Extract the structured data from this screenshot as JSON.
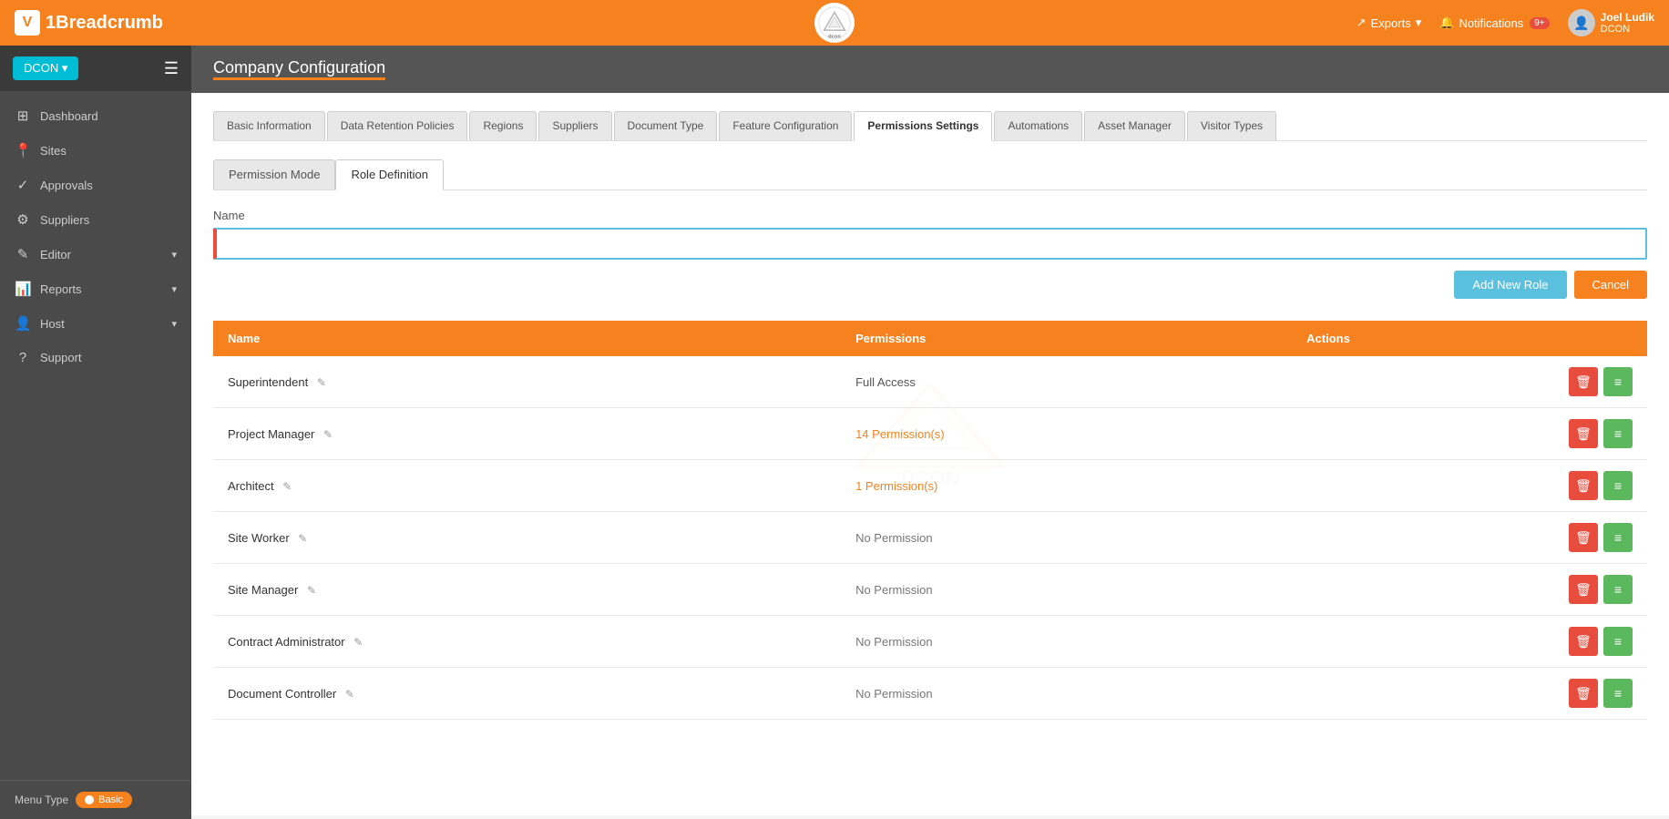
{
  "brand": {
    "logo_char": "V",
    "name": "1Breadcrumb"
  },
  "top_nav": {
    "company_btn": "DCON",
    "exports_label": "Exports",
    "notifications_label": "Notifications",
    "notifications_badge": "9+",
    "user_name": "Joel Ludik",
    "user_company": "DCON"
  },
  "sidebar": {
    "company_btn": "DCON ▾",
    "items": [
      {
        "id": "dashboard",
        "icon": "⊞",
        "label": "Dashboard",
        "has_chevron": false
      },
      {
        "id": "sites",
        "icon": "📍",
        "label": "Sites",
        "has_chevron": false
      },
      {
        "id": "approvals",
        "icon": "✓",
        "label": "Approvals",
        "has_chevron": false
      },
      {
        "id": "suppliers",
        "icon": "⚙",
        "label": "Suppliers",
        "has_chevron": false
      },
      {
        "id": "editor",
        "icon": "✎",
        "label": "Editor",
        "has_chevron": true
      },
      {
        "id": "reports",
        "icon": "📊",
        "label": "Reports",
        "has_chevron": true
      },
      {
        "id": "host",
        "icon": "👤",
        "label": "Host",
        "has_chevron": true
      },
      {
        "id": "support",
        "icon": "?",
        "label": "Support",
        "has_chevron": false
      }
    ],
    "menu_type_label": "Menu Type",
    "menu_type_value": "Basic"
  },
  "page": {
    "title": "Company Configuration"
  },
  "tabs": [
    {
      "id": "basic-info",
      "label": "Basic Information",
      "active": false
    },
    {
      "id": "data-retention",
      "label": "Data Retention Policies",
      "active": false
    },
    {
      "id": "regions",
      "label": "Regions",
      "active": false
    },
    {
      "id": "suppliers",
      "label": "Suppliers",
      "active": false
    },
    {
      "id": "document-type",
      "label": "Document Type",
      "active": false
    },
    {
      "id": "feature-config",
      "label": "Feature Configuration",
      "active": false
    },
    {
      "id": "permissions",
      "label": "Permissions Settings",
      "active": true
    },
    {
      "id": "automations",
      "label": "Automations",
      "active": false
    },
    {
      "id": "asset-manager",
      "label": "Asset Manager",
      "active": false
    },
    {
      "id": "visitor-types",
      "label": "Visitor Types",
      "active": false
    }
  ],
  "sub_tabs": [
    {
      "id": "permission-mode",
      "label": "Permission Mode",
      "active": false
    },
    {
      "id": "role-definition",
      "label": "Role Definition",
      "active": true
    }
  ],
  "form": {
    "name_label": "Name",
    "name_placeholder": "",
    "add_button": "Add New Role",
    "cancel_button": "Cancel"
  },
  "table": {
    "columns": [
      "Name",
      "Permissions",
      "Actions"
    ],
    "rows": [
      {
        "name": "Superintendent",
        "permissions": "Full Access",
        "is_link": false
      },
      {
        "name": "Project Manager",
        "permissions": "14 Permission(s)",
        "is_link": true
      },
      {
        "name": "Architect",
        "permissions": "1 Permission(s)",
        "is_link": true
      },
      {
        "name": "Site Worker",
        "permissions": "No Permission",
        "is_link": false
      },
      {
        "name": "Site Manager",
        "permissions": "No Permission",
        "is_link": false
      },
      {
        "name": "Contract Administrator",
        "permissions": "No Permission",
        "is_link": false
      },
      {
        "name": "Document Controller",
        "permissions": "No Permission",
        "is_link": false
      }
    ]
  }
}
